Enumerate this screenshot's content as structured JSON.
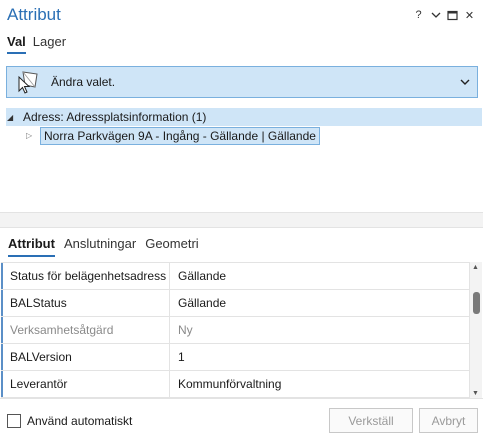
{
  "window": {
    "title": "Attribut",
    "controls": {
      "help": "?",
      "menu_icon": "chevron-down-icon",
      "restore_icon": "restore-icon",
      "close": "✕"
    }
  },
  "top_tabs": [
    {
      "label": "Val",
      "active": true
    },
    {
      "label": "Lager",
      "active": false
    }
  ],
  "selection": {
    "label": "Ändra valet.",
    "icon": "select-features-icon"
  },
  "tree": {
    "layer_label": "Adress: Adressplatsinformation (1)",
    "feature_label": "Norra Parkvägen 9A - Ingång - Gällande | Gällande"
  },
  "bottom_tabs": [
    {
      "label": "Attribut",
      "active": true
    },
    {
      "label": "Anslutningar",
      "active": false
    },
    {
      "label": "Geometri",
      "active": false
    }
  ],
  "attributes": [
    {
      "field": "Status för belägenhetsadress",
      "value": "Gällande",
      "disabled": false
    },
    {
      "field": "BALStatus",
      "value": "Gällande",
      "disabled": false
    },
    {
      "field": "Verksamhetsåtgärd",
      "value": "Ny",
      "disabled": true
    },
    {
      "field": "BALVersion",
      "value": "1",
      "disabled": false
    },
    {
      "field": "Leverantör",
      "value": "Kommunförvaltning",
      "disabled": false
    }
  ],
  "footer": {
    "auto_apply_label": "Använd automatiskt",
    "auto_apply_checked": false,
    "apply_label": "Verkställ",
    "cancel_label": "Avbryt"
  },
  "colors": {
    "accent": "#2a6fb5",
    "selection_bg": "#cfe5f7",
    "selection_border": "#7ab0de"
  }
}
